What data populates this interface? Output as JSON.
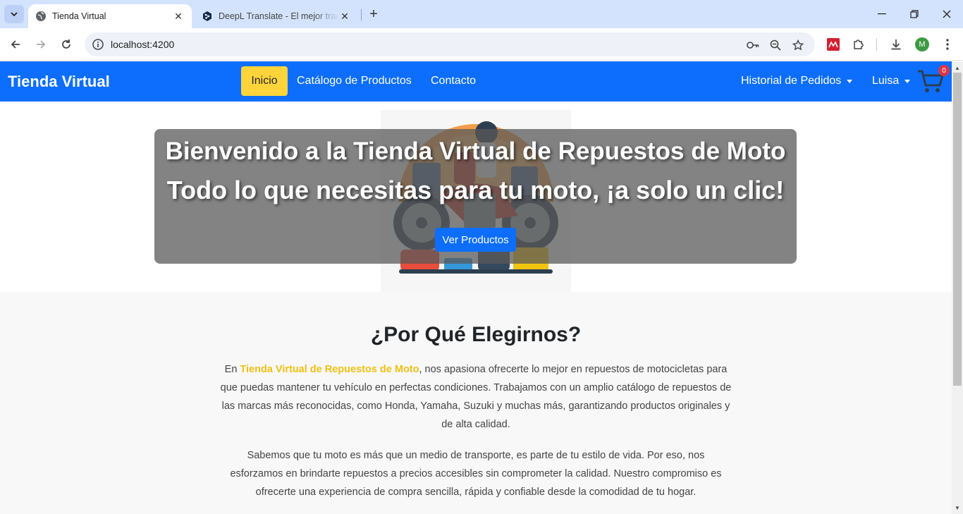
{
  "browser": {
    "tabs": [
      {
        "title": "Tienda Virtual",
        "active": true
      },
      {
        "title": "DeepL Translate - El mejor traductor del mundo",
        "active": false
      }
    ],
    "url": "localhost:4200",
    "profile_initial": "M",
    "colors": {
      "tabstrip": "#d3e3fd",
      "omnibox": "#eef1f8",
      "profile": "#3f9b43"
    }
  },
  "site": {
    "brand": "Tienda Virtual",
    "nav": {
      "inicio": "Inicio",
      "catalogo": "Catálogo de Productos",
      "contacto": "Contacto",
      "historial": "Historial de Pedidos",
      "user": "Luisa",
      "cart_count": "0"
    },
    "hero": {
      "title": "Bienvenido a la Tienda Virtual de Repuestos de Moto",
      "subtitle": "Todo lo que necesitas para tu moto, ¡a solo un clic!",
      "button": "Ver Productos"
    },
    "why": {
      "title": "¿Por Qué Elegirnos?",
      "p1_prefix": "En ",
      "p1_highlight": "Tienda Virtual de Repuestos de Moto",
      "p1_rest": ", nos apasiona ofrecerte lo mejor en repuestos de motocicletas para que puedas mantener tu vehículo en perfectas condiciones. Trabajamos con un amplio catálogo de repuestos de las marcas más reconocidas, como Honda, Yamaha, Suzuki y muchas más, garantizando productos originales y de alta calidad.",
      "p2": "Sabemos que tu moto es más que un medio de transporte, es parte de tu estilo de vida. Por eso, nos esforzamos en brindarte repuestos a precios accesibles sin comprometer la calidad. Nuestro compromiso es ofrecerte una experiencia de compra sencilla, rápida y confiable desde la comodidad de tu hogar."
    },
    "colors": {
      "primary": "#0d6efd",
      "active_nav": "#ffd43b",
      "highlight": "#f2c012",
      "badge": "#dc3545"
    }
  }
}
